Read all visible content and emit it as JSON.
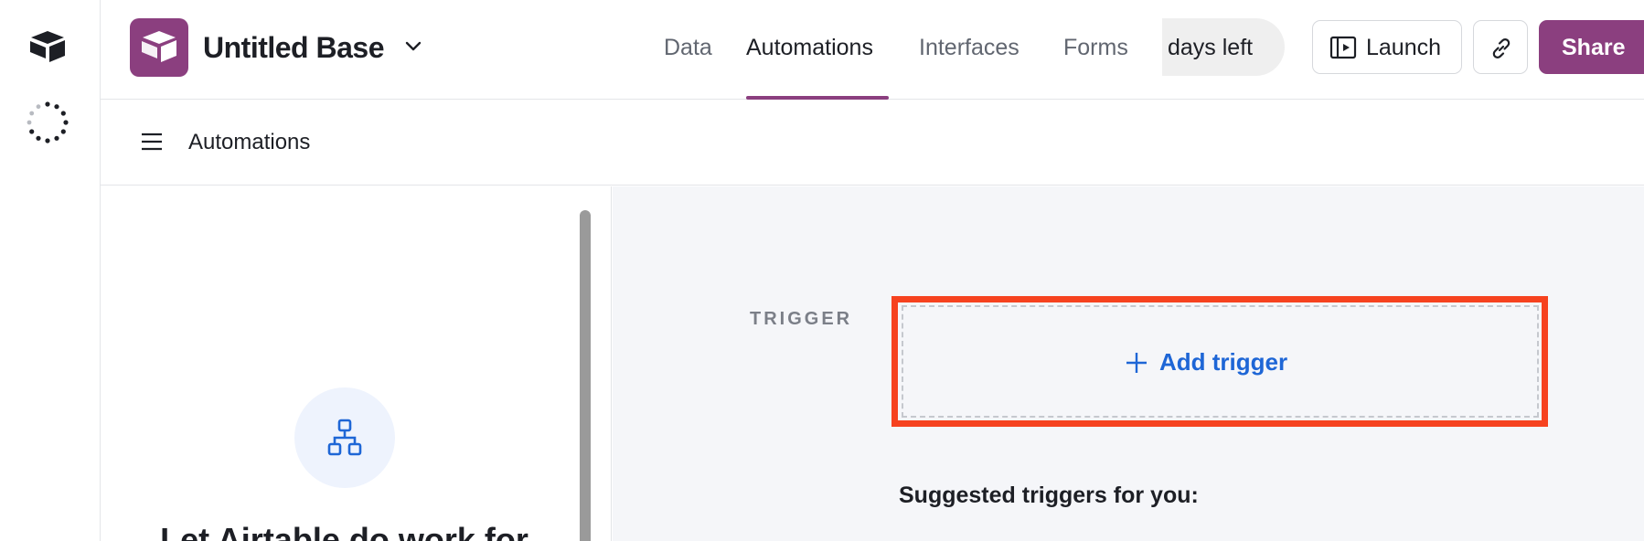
{
  "colors": {
    "brand": "#8b3f7f",
    "accent": "#1e66d6",
    "highlight": "#f6421f"
  },
  "rail": {
    "logo_icon": "airtable-logo-icon",
    "loader_icon": "loading-spinner-icon"
  },
  "header": {
    "base_icon": "base-cube-icon",
    "base_title": "Untitled Base",
    "tabs": [
      {
        "label": "Data",
        "active": false
      },
      {
        "label": "Automations",
        "active": true
      },
      {
        "label": "Interfaces",
        "active": false
      },
      {
        "label": "Forms",
        "active": false
      }
    ],
    "trial_text": "days left",
    "launch_label": "Launch",
    "share_label": "Share"
  },
  "subbar": {
    "title": "Automations"
  },
  "left_panel": {
    "empty_title": "Let Airtable do work for"
  },
  "canvas": {
    "trigger_label": "TRIGGER",
    "add_trigger_label": "Add trigger",
    "suggested_title": "Suggested triggers for you:"
  }
}
